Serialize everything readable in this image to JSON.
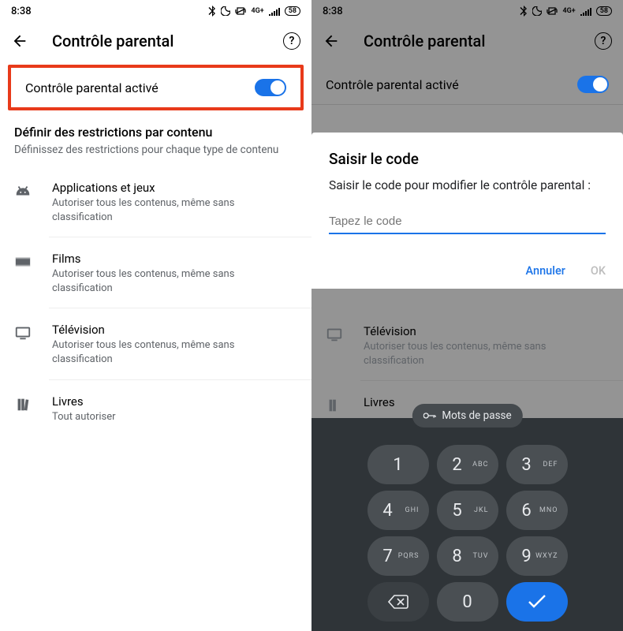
{
  "status": {
    "time": "8:38",
    "battery": "58"
  },
  "titlebar": {
    "title": "Contrôle parental"
  },
  "toggle": {
    "label": "Contrôle parental activé"
  },
  "section": {
    "heading": "Définir des restrictions par contenu",
    "sub": "Définissez des restrictions pour chaque type de contenu"
  },
  "items": [
    {
      "title": "Applications et jeux",
      "sub": "Autoriser tous les contenus, même sans classification"
    },
    {
      "title": "Films",
      "sub": "Autoriser tous les contenus, même sans classification"
    },
    {
      "title": "Télévision",
      "sub": "Autoriser tous les contenus, même sans classification"
    },
    {
      "title": "Livres",
      "sub": "Tout autoriser"
    }
  ],
  "dialog": {
    "title": "Saisir le code",
    "message": "Saisir le code pour modifier le contrôle parental :",
    "placeholder": "Tapez le code",
    "cancel": "Annuler",
    "ok": "OK"
  },
  "keyboard": {
    "password_chip": "Mots de passe",
    "keys": [
      [
        {
          "n": "1",
          "l": ""
        },
        {
          "n": "2",
          "l": "ABC"
        },
        {
          "n": "3",
          "l": "DEF"
        }
      ],
      [
        {
          "n": "4",
          "l": "GHI"
        },
        {
          "n": "5",
          "l": "JKL"
        },
        {
          "n": "6",
          "l": "MNO"
        }
      ],
      [
        {
          "n": "7",
          "l": "PQRS"
        },
        {
          "n": "8",
          "l": "TUV"
        },
        {
          "n": "9",
          "l": "WXYZ"
        }
      ],
      [
        {
          "n": "bksp",
          "l": ""
        },
        {
          "n": "0",
          "l": ""
        },
        {
          "n": "submit",
          "l": ""
        }
      ]
    ]
  }
}
